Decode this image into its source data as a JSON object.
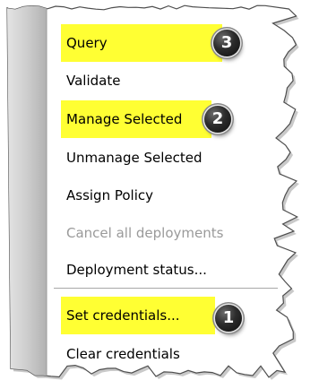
{
  "menu": {
    "items": [
      {
        "label": "Query",
        "highlight": "#ffff33",
        "badge": "3",
        "disabled": false
      },
      {
        "label": "Validate",
        "highlight": "",
        "badge": "",
        "disabled": false
      },
      {
        "label": "Manage Selected",
        "highlight": "#ffff33",
        "badge": "2",
        "disabled": false
      },
      {
        "label": "Unmanage Selected",
        "highlight": "",
        "badge": "",
        "disabled": false
      },
      {
        "label": "Assign Policy",
        "highlight": "",
        "badge": "",
        "disabled": false
      },
      {
        "label": "Cancel all deployments",
        "highlight": "",
        "badge": "",
        "disabled": true
      },
      {
        "label": "Deployment status...",
        "highlight": "",
        "badge": "",
        "disabled": false
      },
      {
        "label": "Set credentials...",
        "highlight": "#ffff33",
        "badge": "1",
        "disabled": false
      },
      {
        "label": "Clear credentials",
        "highlight": "",
        "badge": "",
        "disabled": false
      }
    ]
  },
  "colors": {
    "highlight": "#ffff33",
    "text": "#000000",
    "disabled_text": "#9a9a9a",
    "gutter": "#b9b9b9",
    "badge": "#1a1a1a"
  }
}
